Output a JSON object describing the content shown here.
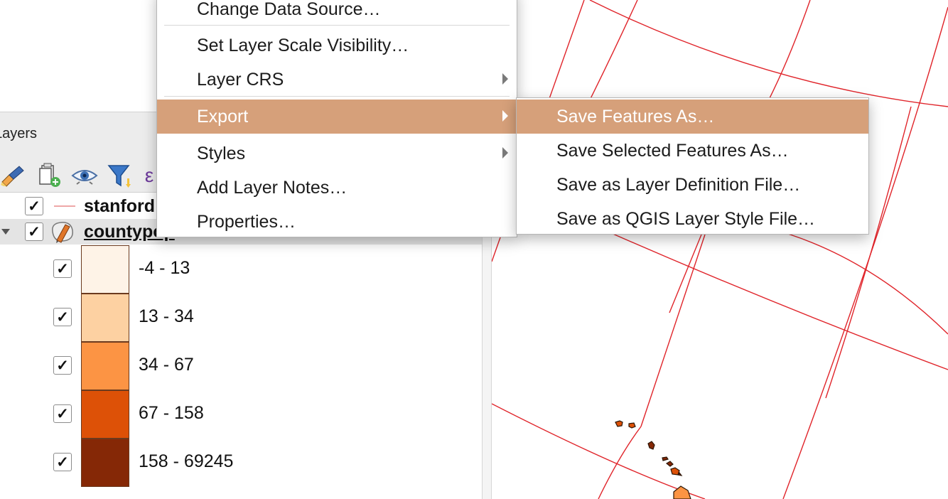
{
  "layers_panel": {
    "title": "Layers",
    "toolbar": {
      "icons": [
        "style-brush-icon",
        "add-group-icon",
        "visibility-eye-icon",
        "filter-funnel-icon",
        "expression-icon"
      ]
    },
    "layers": [
      {
        "name": "stanford",
        "checked": true,
        "icon": "line-symbol-icon"
      },
      {
        "name": "countypop",
        "checked": true,
        "icon": "polygon-edit-icon",
        "expanded": true
      }
    ],
    "classes": [
      {
        "label": "-4 - 13",
        "color": "#fef3e7"
      },
      {
        "label": "13 - 34",
        "color": "#fdd1a2"
      },
      {
        "label": "34 - 67",
        "color": "#fc9444"
      },
      {
        "label": "67 - 158",
        "color": "#dd5107"
      },
      {
        "label": "158 - 69245",
        "color": "#852806"
      }
    ],
    "check_mark": "✓"
  },
  "context_menu": {
    "items": [
      {
        "label": "Change Data Source…",
        "mnemonic": "h"
      },
      {
        "label": "Set Layer Scale Visibility…",
        "mnemonic": "V"
      },
      {
        "label": "Layer CRS",
        "submenu": true
      },
      {
        "label": "Export",
        "submenu": true,
        "highlighted": true,
        "mnemonic": "x"
      },
      {
        "label": "Styles",
        "submenu": true
      },
      {
        "label": "Add Layer Notes…"
      },
      {
        "label": "Properties…",
        "mnemonic": "P"
      }
    ]
  },
  "export_submenu": {
    "items": [
      {
        "label": "Save Features As…",
        "highlighted": true,
        "mnemonic": "A"
      },
      {
        "label": "Save Selected Features As…",
        "mnemonic": "S"
      },
      {
        "label": "Save as Layer Definition File…",
        "mnemonic": "D"
      },
      {
        "label": "Save as QGIS Layer Style File…",
        "mnemonic": "Q"
      }
    ]
  },
  "colors": {
    "menu_highlight": "#d6a07a",
    "graticule": "#e0242a",
    "panel_bg": "#ececec"
  }
}
